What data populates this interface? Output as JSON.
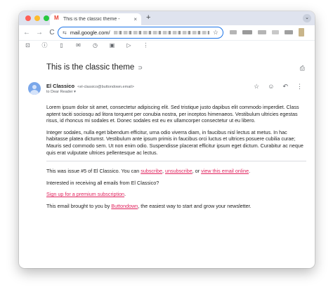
{
  "browser": {
    "tab_title": "This is the classic theme - ",
    "tab_close": "×",
    "new_tab": "+",
    "tab_menu": "⌄",
    "url": "mail.google.com/",
    "back": "←",
    "forward": "→",
    "reload": "C"
  },
  "email": {
    "subject": "This is the classic theme",
    "sender_name": "El Classico",
    "sender_email": "<el-classico@buttondown.email>",
    "to_line": "to Dear Reader",
    "paragraphs": [
      "Lorem ipsum dolor sit amet, consectetur adipiscing elit. Sed tristique justo dapibus elit commodo imperdiet. Class aptent taciti sociosqu ad litora torquent per conubia nostra, per inceptos himenaeos. Vestibulum ultricies egestas risus, id rhoncus mi sodales et. Donec sodales est eu ex ullamcorper consectetur ut eu libero.",
      "Integer sodales, nulla eget bibendum efficitur, urna odio viverra diam, in faucibus nisl lectus at metus. In hac habitasse platea dictumst. Vestibulum ante ipsum primis in faucibus orci luctus et ultrices posuere cubilia curae; Mauris sed commodo sem. Ut non enim odio. Suspendisse placerat efficitur ipsum eget dictum. Curabitur ac neque quis erat vulputate ultrices pellentesque ac lectus."
    ],
    "footer": {
      "issue_text": "This was issue #5 of El Classico. You can ",
      "subscribe": "subscribe",
      "comma": ", ",
      "unsubscribe": "unsubscribe",
      "or": ", or ",
      "view_online": "view this email online",
      "period": ".",
      "interested": "Interested in receiving all emails from El Classico?",
      "premium_link": "Sign up for a premium subscription",
      "premium_period": ".",
      "brought_prefix": "This email brought to you by ",
      "buttondown": "Buttondown",
      "brought_suffix": ", the easiest way to start and grow your newsletter."
    }
  }
}
